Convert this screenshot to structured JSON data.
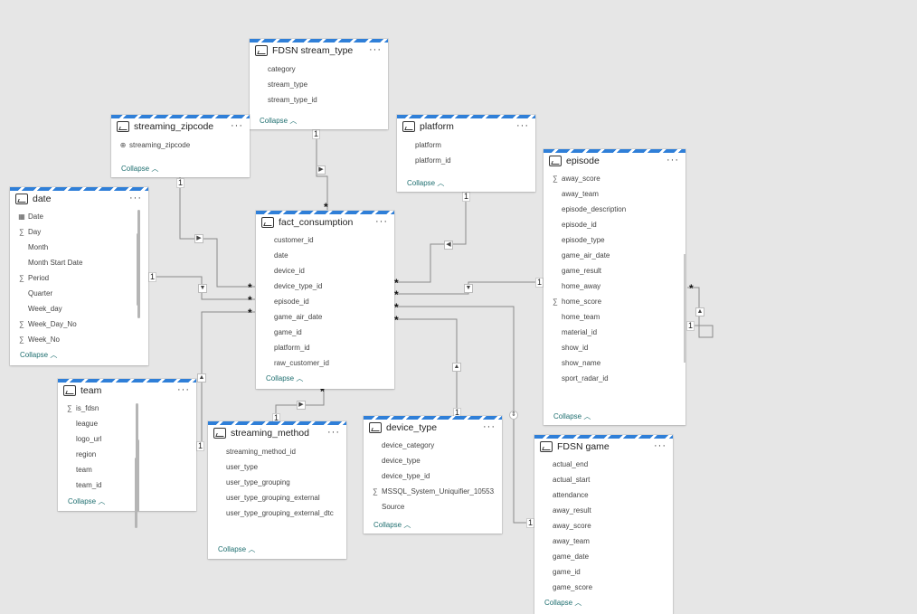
{
  "collapse_label": "Collapse",
  "more_label": "···",
  "cards": {
    "stream_type": {
      "title": "FDSN stream_type",
      "fields": [
        {
          "icon": "",
          "name": "category"
        },
        {
          "icon": "",
          "name": "stream_type"
        },
        {
          "icon": "",
          "name": "stream_type_id"
        }
      ]
    },
    "zipcode": {
      "title": "streaming_zipcode",
      "fields": [
        {
          "icon": "globe-icon",
          "name": "streaming_zipcode"
        }
      ]
    },
    "platform": {
      "title": "platform",
      "fields": [
        {
          "icon": "",
          "name": "platform"
        },
        {
          "icon": "",
          "name": "platform_id"
        }
      ]
    },
    "episode": {
      "title": "episode",
      "fields": [
        {
          "icon": "sigma-icon",
          "name": "away_score"
        },
        {
          "icon": "",
          "name": "away_team"
        },
        {
          "icon": "",
          "name": "episode_description"
        },
        {
          "icon": "",
          "name": "episode_id"
        },
        {
          "icon": "",
          "name": "episode_type"
        },
        {
          "icon": "",
          "name": "game_air_date"
        },
        {
          "icon": "",
          "name": "game_result"
        },
        {
          "icon": "",
          "name": "home_away"
        },
        {
          "icon": "sigma-icon",
          "name": "home_score"
        },
        {
          "icon": "",
          "name": "home_team"
        },
        {
          "icon": "",
          "name": "material_id"
        },
        {
          "icon": "",
          "name": "show_id"
        },
        {
          "icon": "",
          "name": "show_name"
        },
        {
          "icon": "",
          "name": "sport_radar_id"
        }
      ]
    },
    "date": {
      "title": "date",
      "fields": [
        {
          "icon": "calendar-icon",
          "name": "Date"
        },
        {
          "icon": "sigma-icon",
          "name": "Day"
        },
        {
          "icon": "",
          "name": "Month"
        },
        {
          "icon": "",
          "name": "Month Start Date"
        },
        {
          "icon": "sigma-icon",
          "name": "Period"
        },
        {
          "icon": "",
          "name": "Quarter"
        },
        {
          "icon": "",
          "name": "Week_day"
        },
        {
          "icon": "sigma-icon",
          "name": "Week_Day_No"
        },
        {
          "icon": "sigma-icon",
          "name": "Week_No"
        }
      ]
    },
    "fact": {
      "title": "fact_consumption",
      "fields": [
        {
          "icon": "",
          "name": "customer_id"
        },
        {
          "icon": "",
          "name": "date"
        },
        {
          "icon": "",
          "name": "device_id"
        },
        {
          "icon": "",
          "name": "device_type_id"
        },
        {
          "icon": "",
          "name": "episode_id"
        },
        {
          "icon": "",
          "name": "game_air_date"
        },
        {
          "icon": "",
          "name": "game_id"
        },
        {
          "icon": "",
          "name": "platform_id"
        },
        {
          "icon": "",
          "name": "raw_customer_id"
        }
      ]
    },
    "team": {
      "title": "team",
      "fields": [
        {
          "icon": "sigma-icon",
          "name": "is_fdsn"
        },
        {
          "icon": "",
          "name": "league"
        },
        {
          "icon": "",
          "name": "logo_url"
        },
        {
          "icon": "",
          "name": "region"
        },
        {
          "icon": "",
          "name": "team"
        },
        {
          "icon": "",
          "name": "team_id"
        }
      ]
    },
    "streaming_method": {
      "title": "streaming_method",
      "fields": [
        {
          "icon": "",
          "name": "streaming_method_id"
        },
        {
          "icon": "",
          "name": "user_type"
        },
        {
          "icon": "",
          "name": "user_type_grouping"
        },
        {
          "icon": "",
          "name": "user_type_grouping_external"
        },
        {
          "icon": "",
          "name": "user_type_grouping_external_dtc"
        }
      ]
    },
    "device_type": {
      "title": "device_type",
      "fields": [
        {
          "icon": "",
          "name": "device_category"
        },
        {
          "icon": "",
          "name": "device_type"
        },
        {
          "icon": "",
          "name": "device_type_id"
        },
        {
          "icon": "sigma-icon",
          "name": "MSSQL_System_Uniquifier_10553..."
        },
        {
          "icon": "",
          "name": "Source"
        }
      ]
    },
    "game": {
      "title": "FDSN game",
      "fields": [
        {
          "icon": "",
          "name": "actual_end"
        },
        {
          "icon": "",
          "name": "actual_start"
        },
        {
          "icon": "",
          "name": "attendance"
        },
        {
          "icon": "",
          "name": "away_result"
        },
        {
          "icon": "",
          "name": "away_score"
        },
        {
          "icon": "",
          "name": "away_team"
        },
        {
          "icon": "",
          "name": "game_date"
        },
        {
          "icon": "",
          "name": "game_id"
        },
        {
          "icon": "",
          "name": "game_score"
        }
      ]
    }
  },
  "relationship_markers": {
    "one": "1",
    "many": "*"
  }
}
